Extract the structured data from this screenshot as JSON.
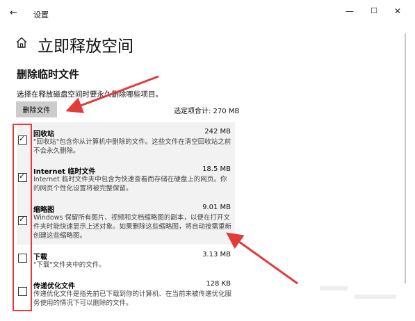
{
  "window": {
    "back_glyph": "←",
    "title": "设置",
    "minimize_glyph": "—",
    "maximize_glyph": "☐",
    "close_glyph": "✕"
  },
  "page": {
    "title": "立即释放空间",
    "section_title": "删除临时文件",
    "description": "选择在释放磁盘空间时要永久删除哪些项目。",
    "delete_button_label": "删除文件",
    "selected_total": "选定项合计: 270 MB"
  },
  "items": [
    {
      "name": "回收站",
      "size": "242 MB",
      "checked": true,
      "description": "\"回收站\"包含你从计算机中删除的文件。这些文件在清空回收站之前不会永久删除。"
    },
    {
      "name": "Internet 临时文件",
      "size": "18.5 MB",
      "checked": true,
      "description": "Internet 临时文件夹中包含为快速查看而存储在硬盘上的网页。你的网页个性化设置将被完整保留。"
    },
    {
      "name": "缩略图",
      "size": "9.01 MB",
      "checked": true,
      "description": "Windows 保留所有图片、视频和文档缩略图的副本，以便在打开文件夹时能快速显示上述对象。如果删除这些缩略图，将自动按需重新创建这些缩略图。"
    },
    {
      "name": "下载",
      "size": "3.13 MB",
      "checked": false,
      "description": "\"下载\"文件夹中的文件。"
    },
    {
      "name": "传递优化文件",
      "size": "128 KB",
      "checked": false,
      "description": "传递优化文件是指先前已下载到你的计算机、在当前未被传递优化服务使用的情况下可以删除的文件。"
    }
  ],
  "colors": {
    "annotation_red": "#e23b3b",
    "list_background": "#f2f2f2",
    "button_background": "#cccccc"
  },
  "icons": {
    "home": "home-icon",
    "back": "back-arrow-icon"
  }
}
